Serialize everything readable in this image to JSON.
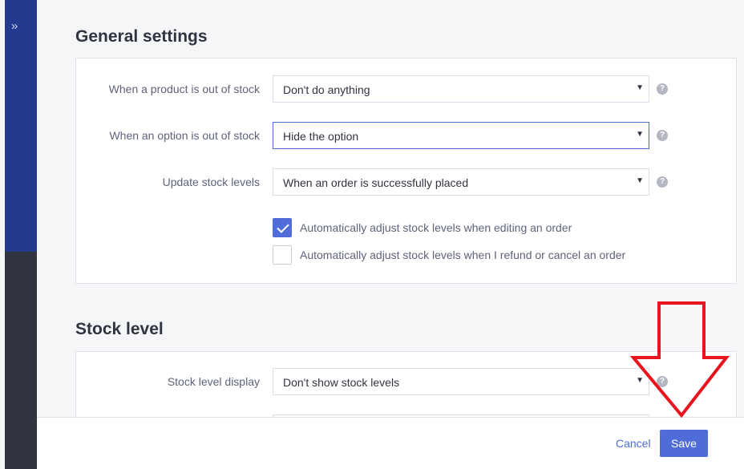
{
  "colors": {
    "rail_top": "#243a8f",
    "rail_bottom": "#313440",
    "accent": "#4f6cd8",
    "annotation": "#e8141e"
  },
  "rail": {
    "expand_icon": "»"
  },
  "general": {
    "title": "General settings",
    "rows": [
      {
        "label": "When a product is out of stock",
        "value": "Don't do anything"
      },
      {
        "label": "When an option is out of stock",
        "value": "Hide the option"
      },
      {
        "label": "Update stock levels",
        "value": "When an order is successfully placed"
      }
    ],
    "checks": [
      {
        "label": "Automatically adjust stock levels when editing an order",
        "checked": true
      },
      {
        "label": "Automatically adjust stock levels when I refund or cancel an order",
        "checked": false
      }
    ]
  },
  "stock": {
    "title": "Stock level",
    "rows": [
      {
        "label": "Stock level display",
        "value": "Don't show stock levels"
      }
    ]
  },
  "icons": {
    "help": "?",
    "caret": "▼"
  },
  "footer": {
    "cancel_label": "Cancel",
    "save_label": "Save"
  },
  "annotation": {
    "icon": "down-arrow-icon",
    "points_to": "save-button"
  }
}
